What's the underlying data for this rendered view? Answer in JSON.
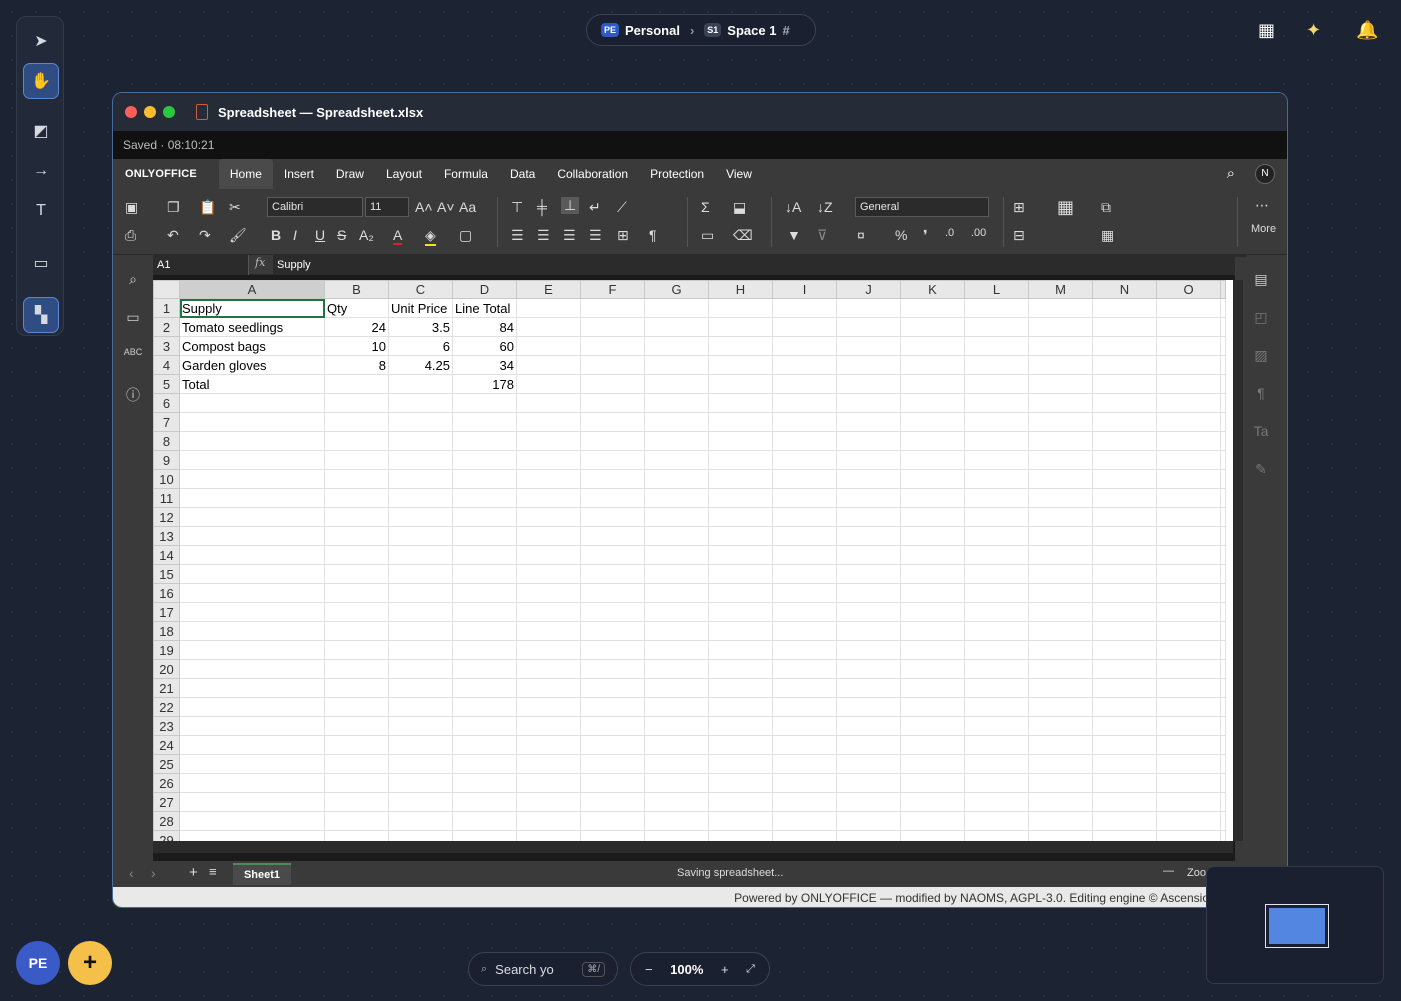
{
  "breadcrumb": {
    "workspace_badge": "PE",
    "workspace": "Personal",
    "space_badge": "S1",
    "space": "Space 1",
    "hash": "#"
  },
  "window": {
    "title": "Spreadsheet — Spreadsheet.xlsx",
    "saved_status": "Saved · 08:10:21"
  },
  "editor": {
    "logo": "ONLYOFFICE",
    "menu": [
      "Home",
      "Insert",
      "Draw",
      "Layout",
      "Formula",
      "Data",
      "Collaboration",
      "Protection",
      "View"
    ],
    "active_menu": "Home",
    "user_initial": "N",
    "font_name": "Calibri",
    "font_size": "11",
    "number_format": "General",
    "more_label": "More",
    "name_box": "A1",
    "fx_label": "fx",
    "formula_value": "Supply"
  },
  "grid": {
    "columns": [
      "A",
      "B",
      "C",
      "D",
      "E",
      "F",
      "G",
      "H",
      "I",
      "J",
      "K",
      "L",
      "M",
      "N",
      "O"
    ],
    "row_count": 29,
    "cells": [
      [
        "Supply",
        "Qty",
        "Unit Price",
        "Line Total"
      ],
      [
        "Tomato seedlings",
        "24",
        "3.5",
        "84"
      ],
      [
        "Compost bags",
        "10",
        "6",
        "60"
      ],
      [
        "Garden gloves",
        "8",
        "4.25",
        "34"
      ],
      [
        "Total",
        "",
        "",
        "178"
      ]
    ]
  },
  "sheetbar": {
    "sheet_name": "Sheet1",
    "status": "Saving spreadsheet...",
    "zoom_label": "Zoo"
  },
  "footer": {
    "text": "Powered by ONLYOFFICE — modified by NAOMS, AGPL-3.0. Editing engine © Ascensio"
  },
  "bottom": {
    "avatar": "PE",
    "add": "+",
    "search_placeholder": "Search yo",
    "search_shortcut": "⌘/",
    "zoom_minus": "−",
    "zoom_value": "100%",
    "zoom_plus": "+",
    "fit": "⤢"
  }
}
